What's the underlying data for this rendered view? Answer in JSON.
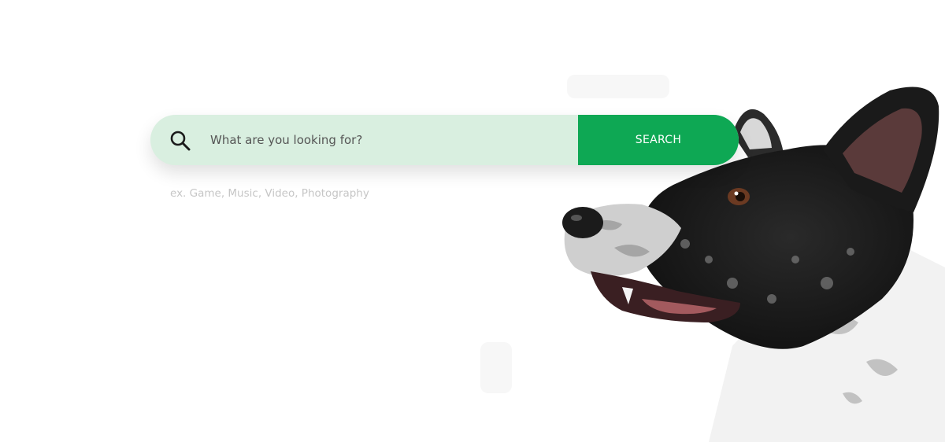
{
  "search": {
    "placeholder": "What are you looking for?",
    "button_label": "SEARCH",
    "hint": "ex. Game, Music, Video, Photography",
    "icon": "search-icon"
  },
  "hero": {
    "image_subject": "black-and-white-dog-photo"
  },
  "colors": {
    "search_field_bg": "#d9efe0",
    "button_bg": "#0ea854",
    "button_text": "#ffffff",
    "hint_text": "#c6c6c6"
  }
}
